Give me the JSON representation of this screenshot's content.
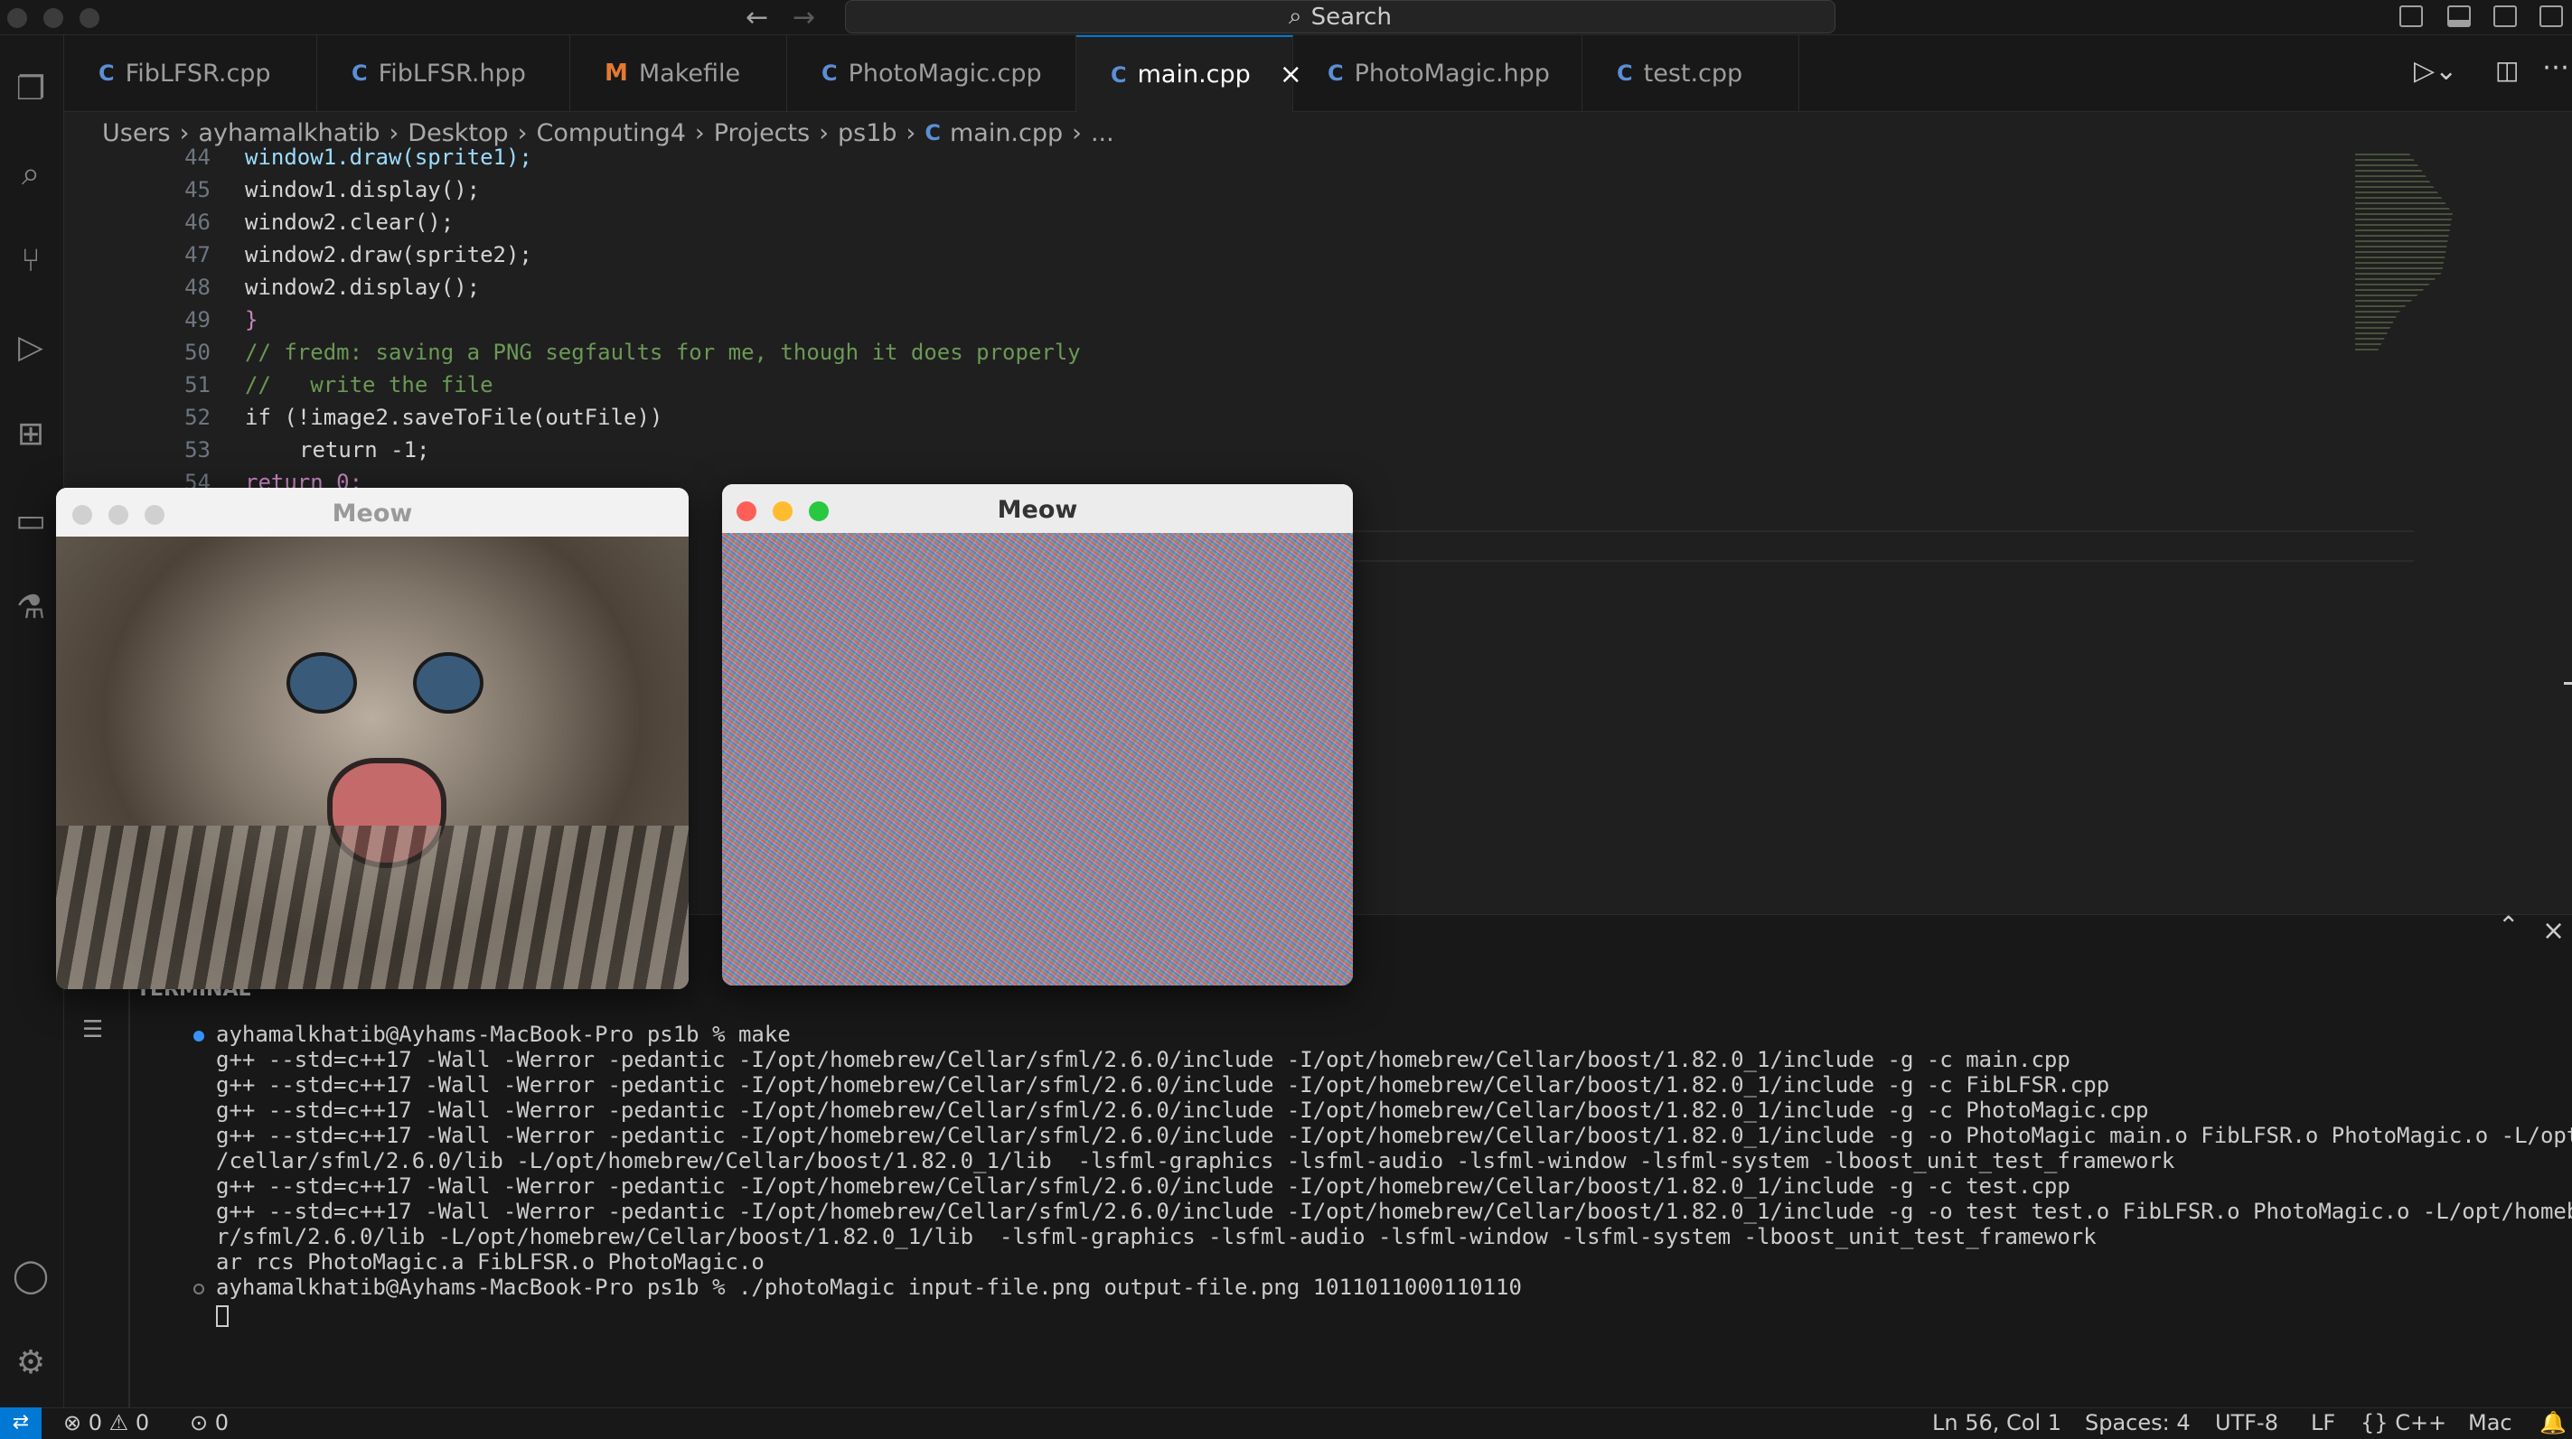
{
  "titlebar": {
    "search_placeholder": "Search",
    "back_icon": "arrow-left-icon",
    "forward_icon": "arrow-right-icon"
  },
  "tabs": [
    {
      "label": "FibLFSR.cpp",
      "icon": "C",
      "active": false
    },
    {
      "label": "FibLFSR.hpp",
      "icon": "C",
      "active": false
    },
    {
      "label": "Makefile",
      "icon": "M",
      "active": false
    },
    {
      "label": "PhotoMagic.cpp",
      "icon": "C",
      "active": false
    },
    {
      "label": "main.cpp",
      "icon": "C",
      "active": true
    },
    {
      "label": "PhotoMagic.hpp",
      "icon": "C",
      "active": false
    },
    {
      "label": "test.cpp",
      "icon": "C",
      "active": false
    }
  ],
  "breadcrumb": [
    "Users",
    "ayhamalkhatib",
    "Desktop",
    "Computing4",
    "Projects",
    "ps1b",
    "main.cpp",
    "..."
  ],
  "editor": {
    "lines": [
      {
        "n": "44",
        "text": "window1.draw(sprite1);"
      },
      {
        "n": "45",
        "text": "window1.display();"
      },
      {
        "n": "46",
        "text": "window2.clear();"
      },
      {
        "n": "47",
        "text": "window2.draw(sprite2);"
      },
      {
        "n": "48",
        "text": "window2.display();"
      },
      {
        "n": "49",
        "text": "}"
      },
      {
        "n": "50",
        "text": "// fredm: saving a PNG segfaults for me, though it does properly"
      },
      {
        "n": "51",
        "text": "//   write the file"
      },
      {
        "n": "52",
        "text": "if (!image2.saveToFile(outFile))"
      },
      {
        "n": "53",
        "text": "return -1;"
      },
      {
        "n": "54",
        "text": "return 0;"
      }
    ]
  },
  "panel": {
    "title": "TERMINAL",
    "lines": [
      "ayhamalkhatib@Ayhams-MacBook-Pro ps1b % make",
      "g++ --std=c++17 -Wall -Werror -pedantic -I/opt/homebrew/Cellar/sfml/2.6.0/include -I/opt/homebrew/Cellar/boost/1.82.0_1/include -g -c main.cpp",
      "g++ --std=c++17 -Wall -Werror -pedantic -I/opt/homebrew/Cellar/sfml/2.6.0/include -I/opt/homebrew/Cellar/boost/1.82.0_1/include -g -c FibLFSR.cpp",
      "g++ --std=c++17 -Wall -Werror -pedantic -I/opt/homebrew/Cellar/sfml/2.6.0/include -I/opt/homebrew/Cellar/boost/1.82.0_1/include -g -c PhotoMagic.cpp",
      "g++ --std=c++17 -Wall -Werror -pedantic -I/opt/homebrew/Cellar/sfml/2.6.0/include -I/opt/homebrew/Cellar/boost/1.82.0_1/include -g -o PhotoMagic main.o FibLFSR.o PhotoMagic.o -L/opt/homebrew",
      "/cellar/sfml/2.6.0/lib -L/opt/homebrew/Cellar/boost/1.82.0_1/lib  -lsfml-graphics -lsfml-audio -lsfml-window -lsfml-system -lboost_unit_test_framework",
      "g++ --std=c++17 -Wall -Werror -pedantic -I/opt/homebrew/Cellar/sfml/2.6.0/include -I/opt/homebrew/Cellar/boost/1.82.0_1/include -g -c test.cpp",
      "g++ --std=c++17 -Wall -Werror -pedantic -I/opt/homebrew/Cellar/sfml/2.6.0/include -I/opt/homebrew/Cellar/boost/1.82.0_1/include -g -o test test.o FibLFSR.o PhotoMagic.o -L/opt/homebrew/cella",
      "r/sfml/2.6.0/lib -L/opt/homebrew/Cellar/boost/1.82.0_1/lib  -lsfml-graphics -lsfml-audio -lsfml-window -lsfml-system -lboost_unit_test_framework",
      "ar rcs PhotoMagic.a FibLFSR.o PhotoMagic.o",
      "ayhamalkhatib@Ayhams-MacBook-Pro ps1b % ./photoMagic input-file.png output-file.png 1011011000110110"
    ]
  },
  "windows": [
    {
      "title": "Meow",
      "content": "kitten photo"
    },
    {
      "title": "Meow",
      "content": "encrypted noise image"
    }
  ],
  "status": {
    "errors": "0",
    "warnings": "0",
    "ports": "0",
    "position": "Ln 56, Col 1",
    "spaces": "Spaces: 4",
    "encoding": "UTF-8",
    "eol": "LF",
    "language": "C++",
    "os": "Mac"
  },
  "colors": {
    "accent": "#0078d4",
    "close": "#ff5f57",
    "minimize": "#febc2e",
    "zoom": "#28c840",
    "remote": "#0078d4"
  }
}
